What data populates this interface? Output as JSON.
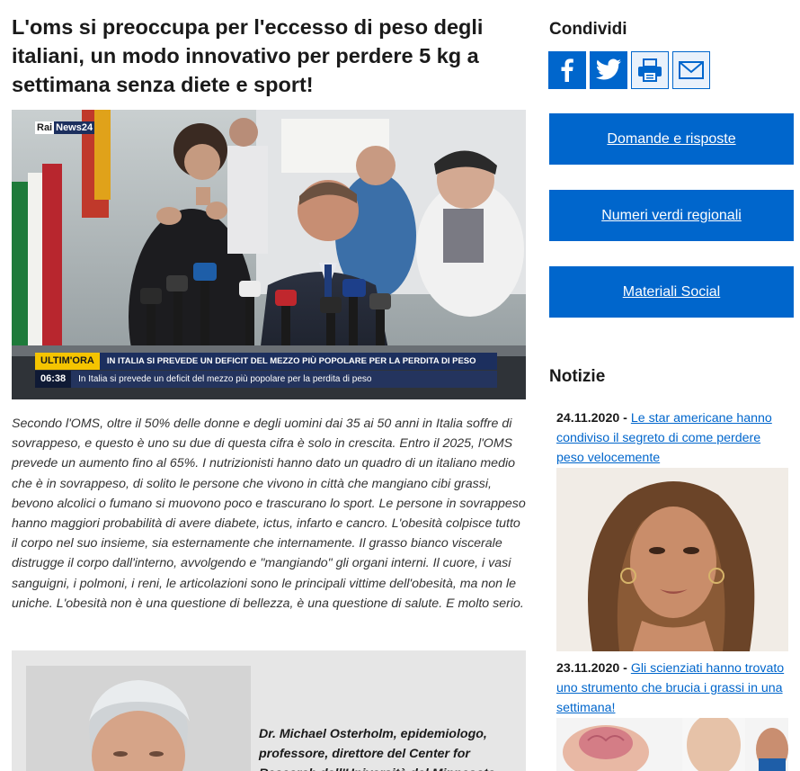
{
  "article": {
    "headline": "L'oms si preoccupa per l'eccesso di peso degli italiani, un modo innovativo per perdere 5 kg a settimana senza diete e sport!",
    "hero": {
      "channel_logo_rai": "Rai",
      "channel_logo_news": "News24",
      "ticker_label": "ULTIM'ORA",
      "ticker_headline": "IN ITALIA SI PREVEDE UN DEFICIT DEL MEZZO PIÙ POPOLARE PER LA PERDITA DI PESO",
      "ticker_time": "06:38",
      "ticker_subline": "In Italia si prevede un deficit del mezzo più popolare per la perdita di peso"
    },
    "body": "Secondo l'OMS, oltre il 50% delle donne e degli uomini dai 35 ai 50 anni in Italia soffre di sovrappeso, e questo è uno su due di questa cifra è solo in crescita. Entro il 2025, l'OMS prevede un aumento fino al 65%. I nutrizionisti hanno dato un quadro di un italiano medio che è in sovrappeso, di solito le persone che vivono in città che mangiano cibi grassi, bevono alcolici o fumano si muovono poco e trascurano lo sport. Le persone in sovrappeso hanno maggiori probabilità di avere diabete, ictus, infarto e cancro. L'obesità colpisce tutto il corpo nel suo insieme, sia esternamente che internamente. Il grasso bianco viscerale distrugge il corpo dall'interno, avvolgendo e \"mangiando\" gli organi interni. Il cuore, i vasi sanguigni, i polmoni, i reni, le articolazioni sono le principali vittime dell'obesità, ma non le uniche. L'obesità non è una questione di bellezza, è una questione di salute. E molto serio.",
    "expert_caption": "Dr. Michael Osterholm, epidemiologo, professore, direttore del Center for Research dell'Università del Minnesota"
  },
  "sidebar": {
    "share_title": "Condividi",
    "share_buttons": [
      {
        "icon": "facebook-icon"
      },
      {
        "icon": "twitter-icon"
      },
      {
        "icon": "print-icon"
      },
      {
        "icon": "mail-icon"
      }
    ],
    "links": [
      {
        "label": "Domande e risposte"
      },
      {
        "label": "Numeri verdi regionali"
      },
      {
        "label": "Materiali Social"
      }
    ],
    "news_title": "Notizie",
    "news": [
      {
        "date": "24.11.2020",
        "separator": " - ",
        "title": "Le star americane hanno condiviso il segreto di come perdere peso velocemente"
      },
      {
        "date": "23.11.2020",
        "separator": " - ",
        "title": "Gli scienziati hanno trovato uno strumento che brucia i grassi in una settimana!"
      }
    ]
  },
  "colors": {
    "accent": "#0066cc",
    "ticker_yellow": "#f5c400",
    "ticker_navy": "#1c2f5e"
  }
}
